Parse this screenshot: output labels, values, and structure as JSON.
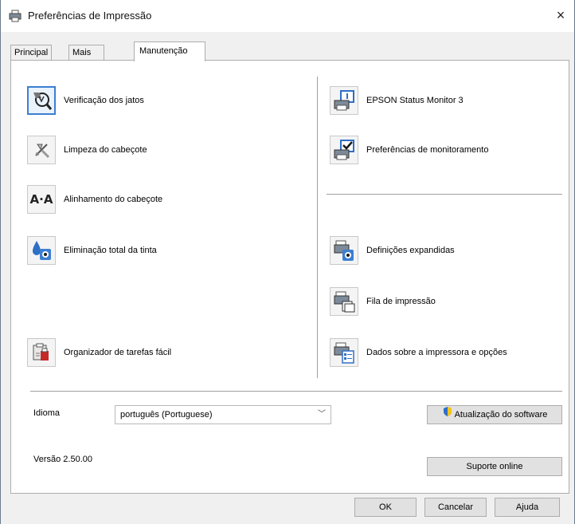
{
  "window": {
    "title": "Preferências de Impressão",
    "close_glyph": "×"
  },
  "tabs": [
    {
      "label": "Principal",
      "active": false
    },
    {
      "label": "Mais opções",
      "active": false
    },
    {
      "label": "Manutenção",
      "active": true
    }
  ],
  "left_items": [
    {
      "label": "Verificação dos jatos",
      "icon": "nozzle-check-icon",
      "selected": true
    },
    {
      "label": "Limpeza do cabeçote",
      "icon": "head-cleaning-icon",
      "selected": false
    },
    {
      "label": "Alinhamento do cabeçote",
      "icon": "head-alignment-icon",
      "icon_text": "A·A",
      "selected": false
    },
    {
      "label": "Eliminação total da tinta",
      "icon": "ink-flush-icon",
      "selected": false
    },
    {
      "label": "Organizador de tarefas fácil",
      "icon": "job-arranger-icon",
      "selected": false
    }
  ],
  "right_items": [
    {
      "label": "EPSON Status Monitor 3",
      "icon": "status-monitor-icon"
    },
    {
      "label": "Preferências de monitoramento",
      "icon": "monitoring-preferences-icon"
    },
    {
      "label": "Definições expandidas",
      "icon": "extended-settings-icon"
    },
    {
      "label": "Fila de impressão",
      "icon": "print-queue-icon"
    },
    {
      "label": "Dados sobre a impressora e opções",
      "icon": "printer-info-icon"
    }
  ],
  "language": {
    "label": "Idioma",
    "value": "português (Portuguese)"
  },
  "software_update_label": "Atualização do software",
  "version_text": "Versão 2.50.00",
  "online_support_label": "Suporte online",
  "footer": {
    "ok_label": "OK",
    "cancel_label": "Cancelar",
    "help_label": "Ajuda"
  },
  "colors": {
    "accent": "#3c7fd1",
    "shield_blue": "#2f6fc6",
    "shield_yellow": "#f5c518"
  }
}
